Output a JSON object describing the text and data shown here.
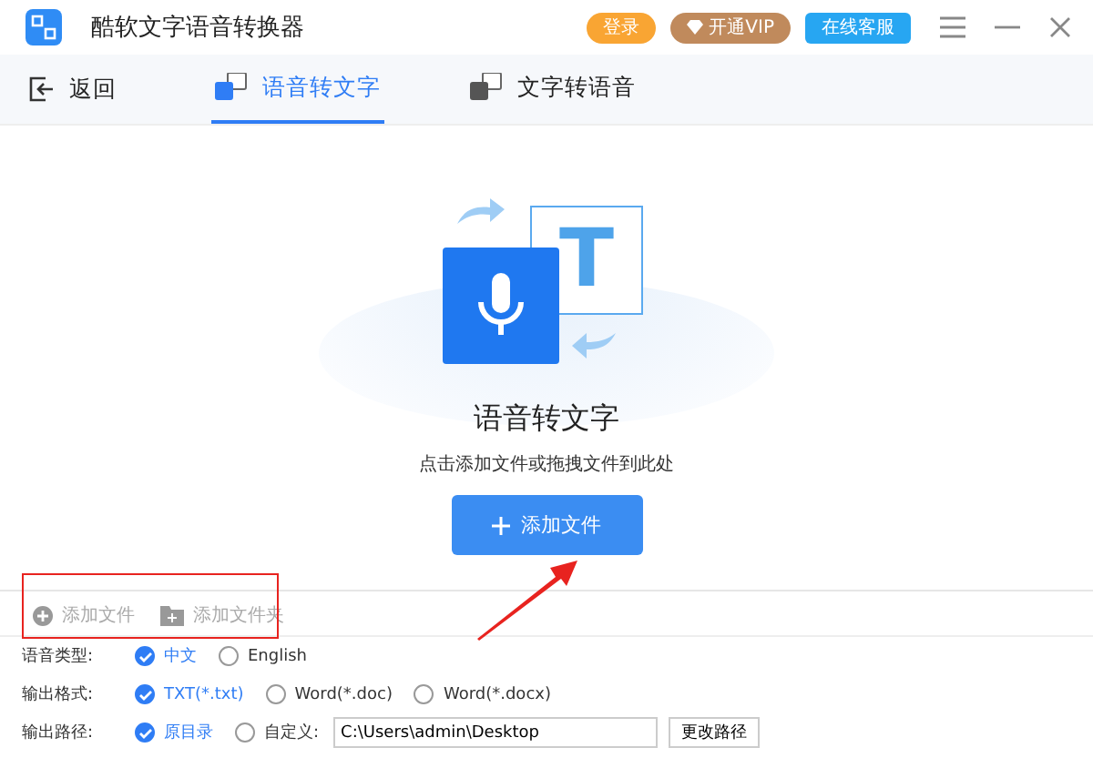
{
  "window": {
    "title": "酷软文字语音转换器",
    "buttons": [
      {
        "label": "登录",
        "kind": "login"
      },
      {
        "label": "开通VIP",
        "kind": "vip"
      },
      {
        "label": "在线客服",
        "kind": "service"
      }
    ]
  },
  "nav": {
    "back": "返回",
    "tabs": [
      {
        "label": "语音转文字",
        "selected": true,
        "kind": "speech"
      },
      {
        "label": "文字转语音",
        "selected": false,
        "kind": "text"
      }
    ]
  },
  "hero": {
    "letter": "T",
    "title": "语音转文字",
    "hint": "点击添加文件或拖拽文件到此处",
    "button": "添加文件"
  },
  "toolbar": [
    {
      "label": "添加文件",
      "kind": "file"
    },
    {
      "label": "添加文件夹",
      "kind": "folder"
    }
  ],
  "options": [
    {
      "label": "语音类型:",
      "choices": [
        {
          "label": "中文",
          "selected": true
        },
        {
          "label": "English",
          "selected": false
        }
      ]
    },
    {
      "label": "输出格式:",
      "choices": [
        {
          "label": "TXT(*.txt)",
          "selected": true
        },
        {
          "label": "Word(*.doc)",
          "selected": false
        },
        {
          "label": "Word(*.docx)",
          "selected": false
        }
      ]
    },
    {
      "label": "输出路径:",
      "choices": [
        {
          "label": "原目录",
          "selected": true
        },
        {
          "label": "自定义:",
          "selected": false
        }
      ],
      "path": "C:\\Users\\admin\\Desktop",
      "button": "更改路径"
    }
  ]
}
